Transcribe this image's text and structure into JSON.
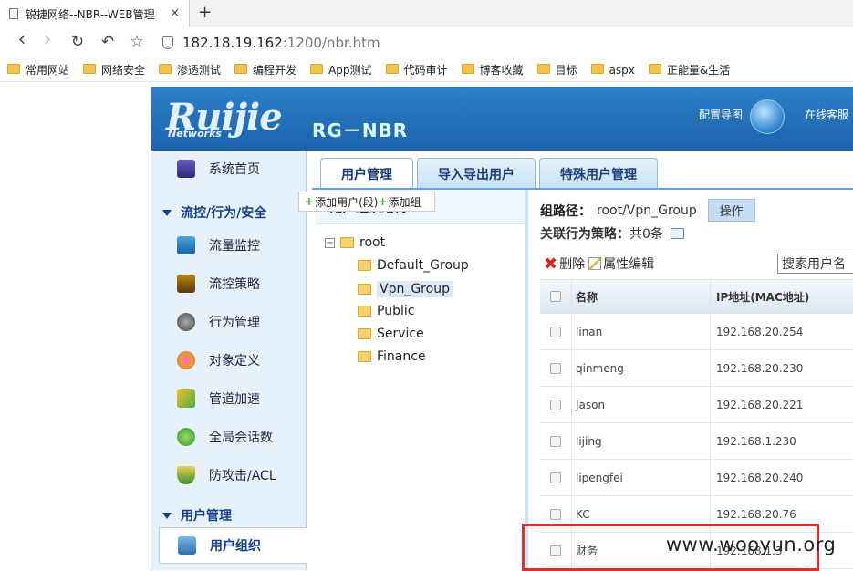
{
  "browser": {
    "tab_title": "锐捷网络--NBR--WEB管理",
    "tab_close": "×",
    "new_tab": "+",
    "nav": {
      "back": "‹",
      "forward": "›",
      "reload": "↻",
      "home": "↶",
      "star": "☆"
    },
    "url_host": "182.18.19.162",
    "url_rest": ":1200/nbr.htm",
    "bookmarks": [
      "常用网站",
      "网络安全",
      "渗透测试",
      "编程开发",
      "App测试",
      "代码审计",
      "博客收藏",
      "目标",
      "aspx",
      "正能量&生活"
    ]
  },
  "app": {
    "logo_text": "Ruijie",
    "logo_sub": "Networks",
    "product": "RG－NBR",
    "header_links": {
      "map": "配置导图",
      "service": "在线客服"
    },
    "sidebar": {
      "top_item": {
        "label": "系统首页",
        "icon": "monitor-icon"
      },
      "section1": "流控/行为/安全",
      "items1": [
        {
          "label": "流量监控",
          "icon": "chart-icon"
        },
        {
          "label": "流控策略",
          "icon": "policy-icon"
        },
        {
          "label": "行为管理",
          "icon": "gear-icon"
        },
        {
          "label": "对象定义",
          "icon": "palette-icon"
        },
        {
          "label": "管道加速",
          "icon": "accelerate-icon"
        },
        {
          "label": "全局会话数",
          "icon": "session-icon"
        },
        {
          "label": "防攻击/ACL",
          "icon": "shield-icon"
        }
      ],
      "section2": "用户管理",
      "active_item": {
        "label": "用户组织",
        "icon": "user-org-icon"
      }
    },
    "tabs": [
      "用户管理",
      "导入导出用户",
      "特殊用户管理"
    ],
    "tree": {
      "header": "用户组织结构",
      "toggle": "−",
      "root": "root",
      "children": [
        "Default_Group",
        "Vpn_Group",
        "Public",
        "Service",
        "Finance"
      ]
    },
    "context_menu": {
      "add_user": "添加用户(段)",
      "add_group": "添加组",
      "plus": "+"
    },
    "detail": {
      "group_path_label": "组路径：",
      "group_path_value": "root/Vpn_Group",
      "op_button": "操作",
      "policy_label": "关联行为策略：",
      "policy_value": "共0条",
      "delete_label": "删除",
      "delete_icon_glyph": "✖",
      "edit_label": "属性编辑",
      "search_value": "搜索用户名"
    },
    "table": {
      "headers": [
        "名称",
        "IP地址(MAC地址)"
      ],
      "rows": [
        {
          "name": "linan",
          "ip": "192.168.20.254"
        },
        {
          "name": "qinmeng",
          "ip": "192.168.20.230"
        },
        {
          "name": "Jason",
          "ip": "192.168.20.221"
        },
        {
          "name": "lijing",
          "ip": "192.168.1.230"
        },
        {
          "name": "lipengfei",
          "ip": "192.168.20.240"
        },
        {
          "name": "KC",
          "ip": "192.168.20.76"
        },
        {
          "name": "财务",
          "ip": "192.168.1.3"
        }
      ]
    }
  },
  "watermark": "www.wooyun.org",
  "colors": {
    "header_blue": "#1b62ae",
    "sidebar_bg": "#e6f1fa",
    "highlight_red": "#d93030",
    "active_text": "#15408a"
  }
}
